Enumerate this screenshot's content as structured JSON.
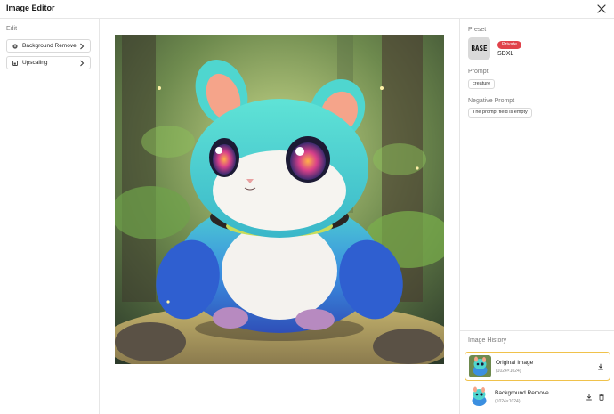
{
  "window": {
    "title": "Image Editor",
    "close_icon": "close-icon"
  },
  "edit_panel": {
    "section_label": "Edit",
    "tools": [
      {
        "label": "Background Remove",
        "icon": "background-remove-icon"
      },
      {
        "label": "Upscaling",
        "icon": "upscale-icon"
      }
    ]
  },
  "preset": {
    "section_label": "Preset",
    "thumbnail_text": "BASE",
    "badge": "Private",
    "name": "SDXL"
  },
  "prompt": {
    "section_label": "Prompt",
    "value": "creature"
  },
  "negative_prompt": {
    "section_label": "Negative Prompt",
    "value": "The prompt field is empty"
  },
  "history": {
    "section_label": "Image History",
    "items": [
      {
        "name": "Original Image",
        "size": "(1024×1024)",
        "selected": true
      },
      {
        "name": "Background Remove",
        "size": "(1024×1024)",
        "selected": false
      }
    ]
  },
  "colors": {
    "accent_selected": "#f0c24b",
    "badge_private": "#e0424a",
    "creature_teal": "#4fd6cf",
    "creature_blue": "#2f5fd0"
  }
}
